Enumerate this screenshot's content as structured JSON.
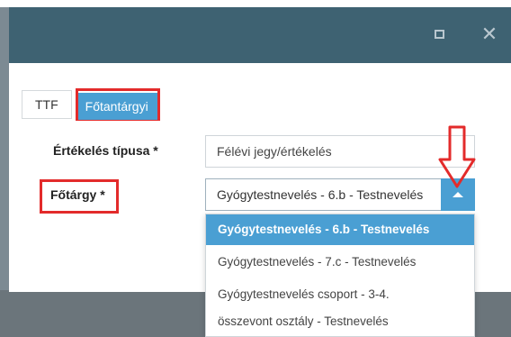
{
  "window": {
    "maximize_icon": "maximize-icon",
    "close_glyph": "✕"
  },
  "tabs": [
    {
      "label": "TTF",
      "active": false
    },
    {
      "label": "Főtantárgyi",
      "active": true
    }
  ],
  "form": {
    "evaluation_type": {
      "label": "Értékelés típusa *",
      "value": "Félévi jegy/értékelés"
    },
    "main_subject": {
      "label": "Főtárgy *",
      "value": "Gyógytestnevelés - 6.b - Testnevelés",
      "options": [
        {
          "line1": "Gyógytestnevelés - 6.b - Testnevelés",
          "line2": "",
          "selected": true
        },
        {
          "line1": "Gyógytestnevelés - 7.c - Testnevelés",
          "line2": "",
          "selected": false
        },
        {
          "line1": "Gyógytestnevelés csoport - 3-4.",
          "line2": "összevont osztály - Testnevelés",
          "selected": false
        }
      ]
    }
  },
  "colors": {
    "titlebar": "#3e6272",
    "accent": "#4a9fd3",
    "highlight_annotation": "#e32b2b"
  }
}
